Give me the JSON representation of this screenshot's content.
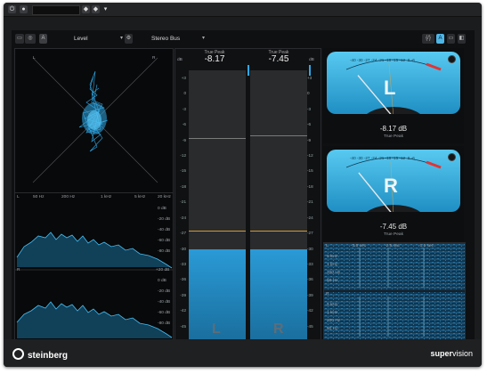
{
  "toolbar": {
    "mode_badge": "A",
    "meter_dropdown": "Level",
    "bus_dropdown": "Stereo Bus",
    "right_badge": "A"
  },
  "scope": {
    "left_label": "L",
    "right_label": "R"
  },
  "spectrum": {
    "freq_labels": [
      "50 Hz",
      "200 Hz",
      "1 kHz",
      "5 kHz",
      "20 kHz"
    ],
    "top_channel": "L",
    "bottom_channel": "R",
    "top_db": [
      "0 dB",
      "-20 dB",
      "-40 dB",
      "-60 dB",
      "-80 dB"
    ],
    "bottom_db": [
      "+20 dB",
      "0 dB",
      "-20 dB",
      "-40 dB",
      "-60 dB",
      "-80 dB"
    ]
  },
  "level_meter": {
    "unit_label": "dB",
    "true_peak_label": "True Peak",
    "left_peak": "-8.17",
    "right_peak": "-7.45",
    "scale": [
      "+3",
      "0",
      "-3",
      "-6",
      "-9",
      "-12",
      "-15",
      "-18",
      "-21",
      "-24",
      "-27",
      "-30",
      "-33",
      "-36",
      "-39",
      "-42",
      "-45"
    ],
    "left_channel": "L",
    "right_channel": "R",
    "left_level_db": -31,
    "right_level_db": -31
  },
  "vu_left": {
    "letter": "L",
    "db": "-8.17 dB",
    "sub": "True Peak",
    "scale": "-40  -30  -27 -24 -21 -18 -15 -12   -9  -6",
    "needle_pct": 0.14
  },
  "vu_right": {
    "letter": "R",
    "db": "-7.45 dB",
    "sub": "True Peak",
    "scale": "-40  -30  -27 -24 -21 -18 -15 -12   -9  -6",
    "needle_pct": 0.15
  },
  "spectrogram": {
    "top_channel": "L",
    "bottom_channel": "R",
    "time_labels": [
      "-3.5 sec",
      "-2.5 sec",
      "-1.5 sec"
    ],
    "freq_labels": [
      "5 kHz",
      "1 kHz",
      "200 Hz",
      "50 Hz"
    ]
  },
  "footer": {
    "brand_left": "steinberg",
    "brand_right_a": "super",
    "brand_right_b": "vision"
  }
}
